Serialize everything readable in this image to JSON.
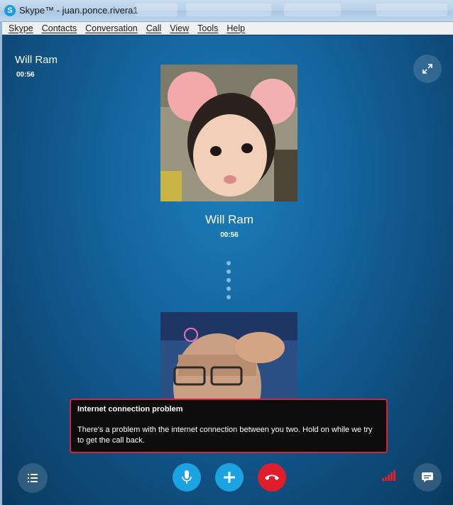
{
  "window": {
    "title": "Skype™ - juan.ponce.rivera1"
  },
  "menu": [
    "Skype",
    "Contacts",
    "Conversation",
    "Call",
    "View",
    "Tools",
    "Help"
  ],
  "call": {
    "contact_name": "Will Ram",
    "duration": "00:56",
    "center_name": "Will Ram",
    "center_duration": "00:56"
  },
  "alert": {
    "title": "Internet connection problem",
    "body": "There's a problem with the internet connection between you two. Hold on while we try to get the call back."
  },
  "icons": {
    "fullscreen": "expand-icon",
    "list": "list-icon",
    "mic": "microphone-icon",
    "add": "plus-icon",
    "end": "hang-up-icon",
    "signal": "signal-strength-icon",
    "chat": "chat-icon"
  },
  "colors": {
    "accent": "#1aa3e0",
    "end_call": "#e01d2b",
    "alert_border": "#d8213b",
    "signal": "#e0202e"
  }
}
